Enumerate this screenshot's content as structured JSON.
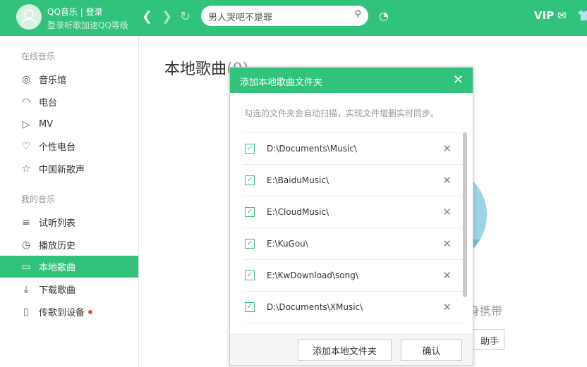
{
  "header": {
    "user": "QQ音乐 | 登录",
    "subtitle": "登录听歌加速QQ等级",
    "search_value": "男人哭吧不是罪",
    "vip": "VIP"
  },
  "sidebar": {
    "online_title": "在线音乐",
    "online": [
      {
        "label": "音乐馆",
        "icon": "music-hall-icon"
      },
      {
        "label": "电台",
        "icon": "radio-icon"
      },
      {
        "label": "MV",
        "icon": "mv-icon"
      },
      {
        "label": "个性电台",
        "icon": "heart-radio-icon"
      },
      {
        "label": "中国新歌声",
        "icon": "star-icon"
      }
    ],
    "mine_title": "我的音乐",
    "mine": [
      {
        "label": "试听列表",
        "icon": "playlist-icon"
      },
      {
        "label": "播放历史",
        "icon": "history-icon"
      },
      {
        "label": "本地歌曲",
        "icon": "monitor-icon"
      },
      {
        "label": "下载歌曲",
        "icon": "download-icon"
      },
      {
        "label": "传歌到设备",
        "icon": "device-icon"
      }
    ]
  },
  "main": {
    "title": "本地歌曲",
    "count": "(0)",
    "bg_text": "身携带",
    "bg_button": "助手"
  },
  "dialog": {
    "title": "添加本地歌曲文件夹",
    "description": "勾选的文件夹会自动扫描，实现文件增删实时同步。",
    "folders": [
      "D:\\Documents\\Music\\",
      "E:\\BaiduMusic\\",
      "E:\\CloudMusic\\",
      "E:\\KuGou\\",
      "E:\\KwDownload\\song\\",
      "D:\\Documents\\XMusic\\"
    ],
    "add_button": "添加本地文件夹",
    "confirm_button": "确认"
  },
  "colors": {
    "accent": "#31c27c"
  }
}
